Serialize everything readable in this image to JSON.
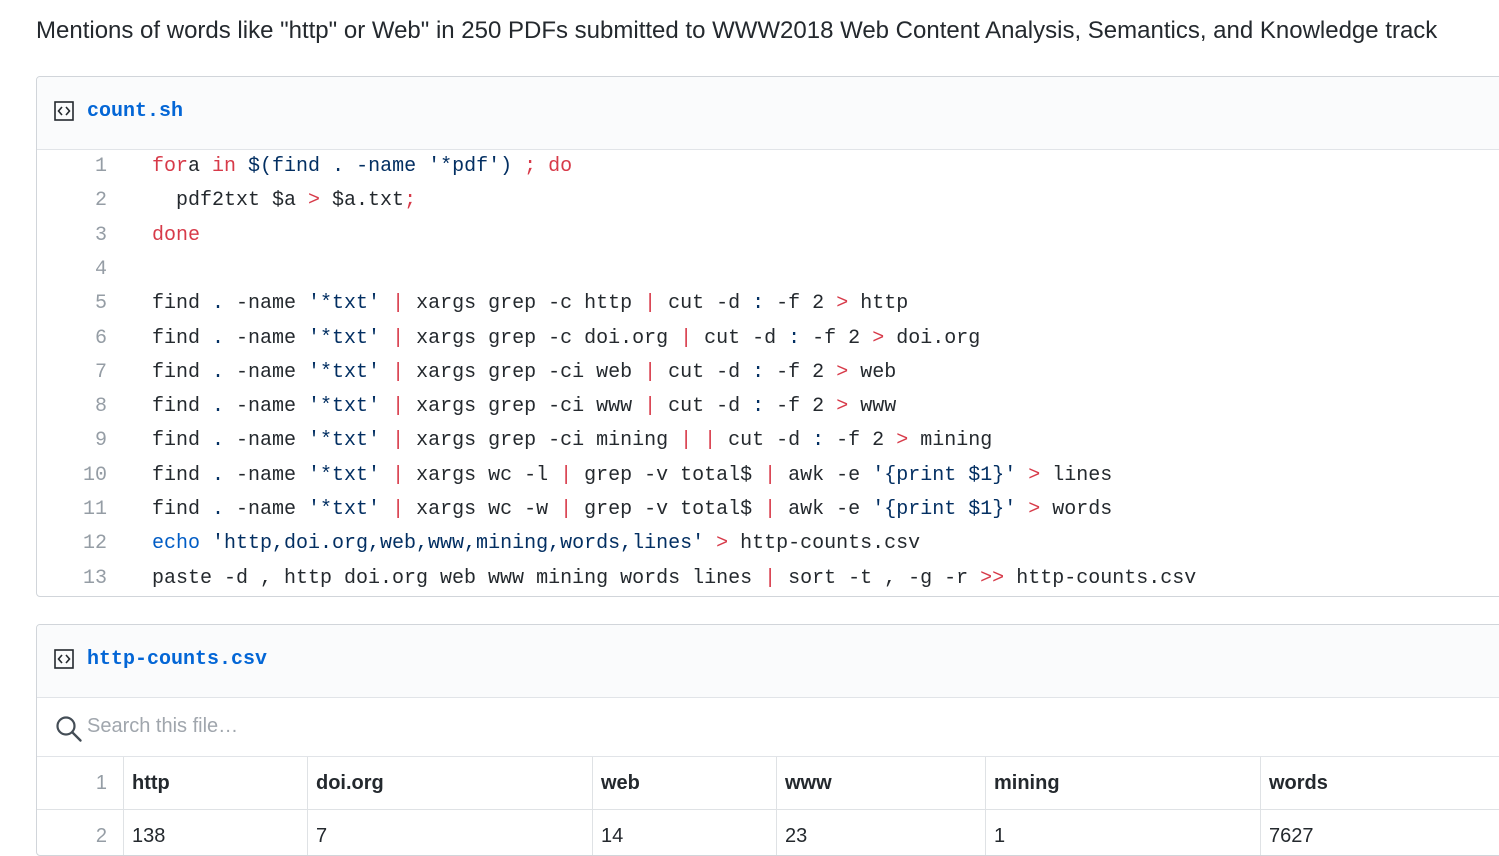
{
  "description": "Mentions of words like \"http\" or Web\" in 250 PDFs submitted to WWW2018 Web Content Analysis, Semantics, and Knowledge track",
  "files": [
    {
      "name": "count.sh",
      "icon": "code-icon",
      "lines": [
        {
          "n": "1",
          "tokens": [
            [
              "k",
              "for"
            ],
            [
              "",
              "a "
            ],
            [
              "k",
              "in"
            ],
            [
              "",
              ""
            ],
            [
              "s",
              " $(find "
            ],
            [
              "s",
              "."
            ],
            [
              "s",
              " -name "
            ],
            [
              "s",
              "'*pdf'"
            ],
            [
              "s",
              ")"
            ],
            [
              "k",
              " ; do"
            ]
          ]
        },
        {
          "n": "2",
          "tokens": [
            [
              "",
              "  pdf2txt $a "
            ],
            [
              "k",
              ">"
            ],
            [
              "",
              " $a.txt"
            ],
            [
              "k",
              ";"
            ]
          ]
        },
        {
          "n": "3",
          "tokens": [
            [
              "k",
              "done"
            ]
          ]
        },
        {
          "n": "4",
          "tokens": []
        },
        {
          "n": "5",
          "tokens": [
            [
              "",
              "find "
            ],
            [
              "s",
              "."
            ],
            [
              "",
              " -name "
            ],
            [
              "s",
              "'*txt'"
            ],
            [
              "k",
              " |"
            ],
            [
              "",
              " xargs grep -c http "
            ],
            [
              "k",
              "|"
            ],
            [
              "",
              " cut -d "
            ],
            [
              "s",
              ":"
            ],
            [
              "",
              " -f 2 "
            ],
            [
              "k",
              ">"
            ],
            [
              "",
              " http"
            ]
          ]
        },
        {
          "n": "6",
          "tokens": [
            [
              "",
              "find "
            ],
            [
              "s",
              "."
            ],
            [
              "",
              " -name "
            ],
            [
              "s",
              "'*txt'"
            ],
            [
              "k",
              " |"
            ],
            [
              "",
              " xargs grep -c doi.org "
            ],
            [
              "k",
              "|"
            ],
            [
              "",
              " cut -d "
            ],
            [
              "s",
              ":"
            ],
            [
              "",
              " -f 2 "
            ],
            [
              "k",
              ">"
            ],
            [
              "",
              " doi.org"
            ]
          ]
        },
        {
          "n": "7",
          "tokens": [
            [
              "",
              "find "
            ],
            [
              "s",
              "."
            ],
            [
              "",
              " -name "
            ],
            [
              "s",
              "'*txt'"
            ],
            [
              "k",
              " |"
            ],
            [
              "",
              " xargs grep -ci web "
            ],
            [
              "k",
              "|"
            ],
            [
              "",
              " cut -d "
            ],
            [
              "s",
              ":"
            ],
            [
              "",
              " -f 2 "
            ],
            [
              "k",
              ">"
            ],
            [
              "",
              " web"
            ]
          ]
        },
        {
          "n": "8",
          "tokens": [
            [
              "",
              "find "
            ],
            [
              "s",
              "."
            ],
            [
              "",
              " -name "
            ],
            [
              "s",
              "'*txt'"
            ],
            [
              "k",
              " |"
            ],
            [
              "",
              " xargs grep -ci www "
            ],
            [
              "k",
              "|"
            ],
            [
              "",
              " cut -d "
            ],
            [
              "s",
              ":"
            ],
            [
              "",
              " -f 2 "
            ],
            [
              "k",
              ">"
            ],
            [
              "",
              " www"
            ]
          ]
        },
        {
          "n": "9",
          "tokens": [
            [
              "",
              "find "
            ],
            [
              "s",
              "."
            ],
            [
              "",
              " -name "
            ],
            [
              "s",
              "'*txt'"
            ],
            [
              "k",
              " |"
            ],
            [
              "",
              " xargs grep -ci mining "
            ],
            [
              "k",
              "| |"
            ],
            [
              "",
              " cut -d "
            ],
            [
              "s",
              ":"
            ],
            [
              "",
              " -f 2 "
            ],
            [
              "k",
              ">"
            ],
            [
              "",
              " mining"
            ]
          ]
        },
        {
          "n": "10",
          "tokens": [
            [
              "",
              "find "
            ],
            [
              "s",
              "."
            ],
            [
              "",
              " -name "
            ],
            [
              "s",
              "'*txt'"
            ],
            [
              "k",
              " |"
            ],
            [
              "",
              " xargs wc -l "
            ],
            [
              "k",
              "|"
            ],
            [
              "",
              " grep -v total$ "
            ],
            [
              "k",
              "|"
            ],
            [
              "",
              " awk -e "
            ],
            [
              "s",
              "'{print $1}'"
            ],
            [
              "k",
              " >"
            ],
            [
              "",
              " lines"
            ]
          ]
        },
        {
          "n": "11",
          "tokens": [
            [
              "",
              "find "
            ],
            [
              "s",
              "."
            ],
            [
              "",
              " -name "
            ],
            [
              "s",
              "'*txt'"
            ],
            [
              "k",
              " |"
            ],
            [
              "",
              " xargs wc -w "
            ],
            [
              "k",
              "|"
            ],
            [
              "",
              " grep -v total$ "
            ],
            [
              "k",
              "|"
            ],
            [
              "",
              " awk -e "
            ],
            [
              "s",
              "'{print $1}'"
            ],
            [
              "k",
              " >"
            ],
            [
              "",
              " words"
            ]
          ]
        },
        {
          "n": "12",
          "tokens": [
            [
              "b",
              "echo"
            ],
            [
              "s",
              " 'http,doi.org,web,www,mining,words,lines'"
            ],
            [
              "k",
              " >"
            ],
            [
              "",
              " http-counts.csv"
            ]
          ]
        },
        {
          "n": "13",
          "tokens": [
            [
              "",
              "paste -d , http doi.org web www mining words lines "
            ],
            [
              "k",
              "|"
            ],
            [
              "",
              " sort -t , -g -r "
            ],
            [
              "k",
              ">>"
            ],
            [
              "",
              " http-counts.csv"
            ]
          ]
        }
      ]
    },
    {
      "name": "http-counts.csv",
      "icon": "code-icon",
      "search": {
        "placeholder": "Search this file…",
        "value": ""
      },
      "header_num": "1",
      "columns": [
        "http",
        "doi.org",
        "web",
        "www",
        "mining",
        "words"
      ],
      "rows": [
        {
          "n": "2",
          "cells": [
            "138",
            "7",
            "14",
            "23",
            "1",
            "7627"
          ]
        }
      ]
    }
  ]
}
